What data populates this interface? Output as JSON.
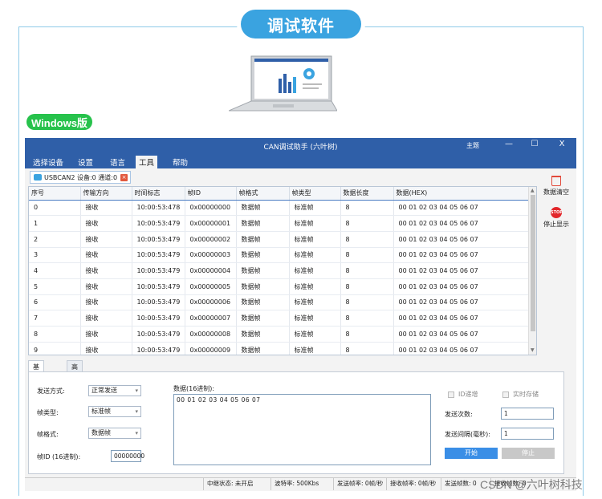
{
  "banner": {
    "title": "调试软件"
  },
  "badge": {
    "label": "Windows版"
  },
  "app": {
    "title": "CAN调试助手 (六叶树)",
    "theme_label": "主题",
    "minimize": "—",
    "maximize": "☐",
    "close": "X",
    "menu": [
      "选择设备",
      "设置",
      "语言",
      "工具",
      "帮助"
    ],
    "active_menu": "工具",
    "device_tab": {
      "label": "USBCAN2 设备:0 通道:0",
      "close": "×"
    },
    "table": {
      "headers": [
        "序号",
        "传输方向",
        "时间标志",
        "帧ID",
        "帧格式",
        "帧类型",
        "数据长度",
        "数据(HEX)"
      ],
      "rows": [
        [
          "0",
          "接收",
          "10:00:53:478",
          "0x00000000",
          "数据帧",
          "标准帧",
          "8",
          "00 01 02 03 04 05 06 07"
        ],
        [
          "1",
          "接收",
          "10:00:53:479",
          "0x00000001",
          "数据帧",
          "标准帧",
          "8",
          "00 01 02 03 04 05 06 07"
        ],
        [
          "2",
          "接收",
          "10:00:53:479",
          "0x00000002",
          "数据帧",
          "标准帧",
          "8",
          "00 01 02 03 04 05 06 07"
        ],
        [
          "3",
          "接收",
          "10:00:53:479",
          "0x00000003",
          "数据帧",
          "标准帧",
          "8",
          "00 01 02 03 04 05 06 07"
        ],
        [
          "4",
          "接收",
          "10:00:53:479",
          "0x00000004",
          "数据帧",
          "标准帧",
          "8",
          "00 01 02 03 04 05 06 07"
        ],
        [
          "5",
          "接收",
          "10:00:53:479",
          "0x00000005",
          "数据帧",
          "标准帧",
          "8",
          "00 01 02 03 04 05 06 07"
        ],
        [
          "6",
          "接收",
          "10:00:53:479",
          "0x00000006",
          "数据帧",
          "标准帧",
          "8",
          "00 01 02 03 04 05 06 07"
        ],
        [
          "7",
          "接收",
          "10:00:53:479",
          "0x00000007",
          "数据帧",
          "标准帧",
          "8",
          "00 01 02 03 04 05 06 07"
        ],
        [
          "8",
          "接收",
          "10:00:53:479",
          "0x00000008",
          "数据帧",
          "标准帧",
          "8",
          "00 01 02 03 04 05 06 07"
        ],
        [
          "9",
          "接收",
          "10:00:53:479",
          "0x00000009",
          "数据帧",
          "标准帧",
          "8",
          "00 01 02 03 04 05 06 07"
        ]
      ]
    },
    "actions": {
      "clear": "数据清空",
      "stop_display": "停止显示",
      "stop_icon_text": "STOP"
    },
    "send_tabs": [
      "基本发送",
      "高级发送"
    ],
    "send": {
      "mode_label": "发送方式:",
      "mode_value": "正常发送",
      "frame_type_label": "帧类型:",
      "frame_type_value": "标准帧",
      "frame_format_label": "帧格式:",
      "frame_format_value": "数据帧",
      "frame_id_label": "帧ID (16进制):",
      "frame_id_value": "00000000",
      "data_label": "数据(16进制):",
      "data_value": "00 01 02 03 04 05 06 07",
      "id_increment": "ID递增",
      "realtime_save": "实时存储",
      "send_count_label": "发送次数:",
      "send_count_value": "1",
      "send_interval_label": "发送间隔(毫秒):",
      "send_interval_value": "1",
      "start": "开始",
      "stop": "停止"
    },
    "status": {
      "interrupt": "中继状态: 未开启",
      "baud": "波特率: 500Kbs",
      "send_rate": "发送帧率: 0帧/秒",
      "recv_rate": "接收帧率: 0帧/秒",
      "send_frames": "发送帧数: 0",
      "recv_frames": "接收帧数: 0"
    }
  },
  "watermark": "CSDN @六叶树科技",
  "colors": {
    "accent": "#2f5fa8",
    "banner": "#3aa3e0",
    "badge": "#27c24c",
    "start_btn": "#3a8ee6",
    "stop_btn": "#c8c8c8"
  }
}
